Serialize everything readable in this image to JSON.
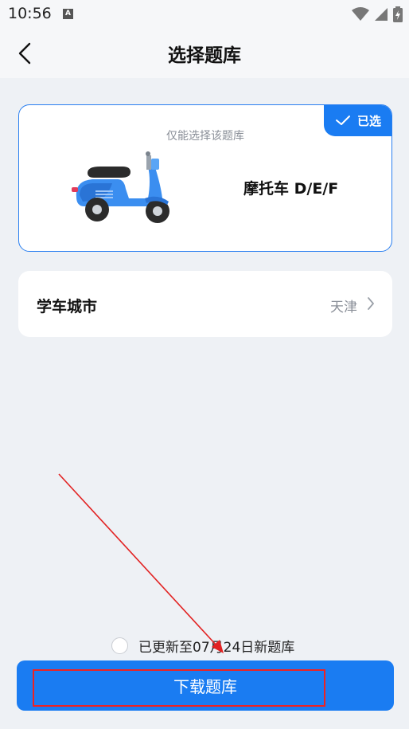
{
  "status_bar": {
    "time": "10:56",
    "notification_letter": "A"
  },
  "header": {
    "title": "选择题库"
  },
  "bank_card": {
    "selected_label": "已选",
    "hint": "仅能选择该题库",
    "name": "摩托车 D/E/F",
    "icon": "scooter-icon"
  },
  "city_row": {
    "label": "学车城市",
    "value": "天津"
  },
  "update_note": {
    "text": "已更新至07月24日新题库"
  },
  "download_button": {
    "label": "下载题库"
  },
  "colors": {
    "accent": "#1a7cf2",
    "background": "#eef1f5",
    "annotation": "#e22222"
  }
}
